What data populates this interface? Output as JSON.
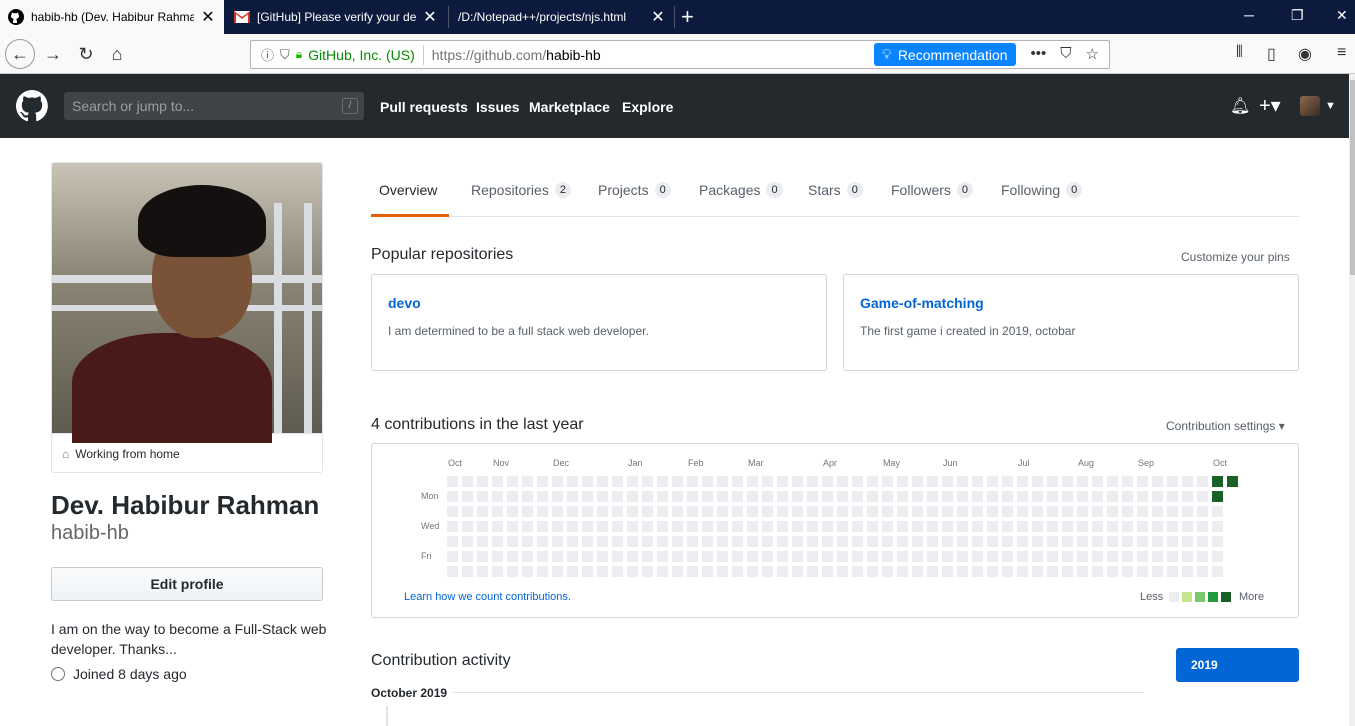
{
  "browser": {
    "tabs": [
      {
        "title": "habib-hb (Dev. Habibur Rahman)",
        "icon": "github-icon",
        "active": true
      },
      {
        "title": "[GitHub] Please verify your device",
        "icon": "gmail-icon",
        "active": false
      },
      {
        "title": "/D:/Notepad++/projects/njs.html",
        "icon": "page-icon",
        "active": false
      }
    ],
    "url_org": "GitHub, Inc. (US)",
    "url_prefix": "https://github.com/",
    "url_path": "habib-hb",
    "recommendation_label": "Recommendation"
  },
  "gh": {
    "search_placeholder": "Search or jump to...",
    "search_key": "/",
    "nav": [
      "Pull requests",
      "Issues",
      "Marketplace",
      "Explore"
    ]
  },
  "profile": {
    "status": "Working from home",
    "name": "Dev. Habibur Rahman",
    "login": "habib-hb",
    "edit_label": "Edit profile",
    "bio": "I am on the way to become a Full-Stack web developer. Thanks...",
    "joined": "Joined 8 days ago"
  },
  "tabs": [
    {
      "label": "Overview",
      "count": null
    },
    {
      "label": "Repositories",
      "count": "2"
    },
    {
      "label": "Projects",
      "count": "0"
    },
    {
      "label": "Packages",
      "count": "0"
    },
    {
      "label": "Stars",
      "count": "0"
    },
    {
      "label": "Followers",
      "count": "0"
    },
    {
      "label": "Following",
      "count": "0"
    }
  ],
  "popular": {
    "title": "Popular repositories",
    "customize": "Customize your pins",
    "repos": [
      {
        "name": "devo",
        "description": "I am determined to be a full stack web developer."
      },
      {
        "name": "Game-of-matching",
        "description": "The first game i created in 2019, octobar"
      }
    ]
  },
  "contrib": {
    "title": "4 contributions in the last year",
    "settings": "Contribution settings",
    "months": [
      "Oct",
      "Nov",
      "Dec",
      "Jan",
      "Feb",
      "Mar",
      "Apr",
      "May",
      "Jun",
      "Jul",
      "Aug",
      "Sep",
      "Oct"
    ],
    "days": [
      "Mon",
      "Wed",
      "Fri"
    ],
    "learn": "Learn how we count contributions.",
    "less": "Less",
    "more": "More",
    "colors": [
      "#ebedf0",
      "#c6e48b",
      "#7bc96f",
      "#239a3b",
      "#196127"
    ]
  },
  "activity": {
    "title": "Contribution activity",
    "year": "2019",
    "month": "October 2019"
  }
}
